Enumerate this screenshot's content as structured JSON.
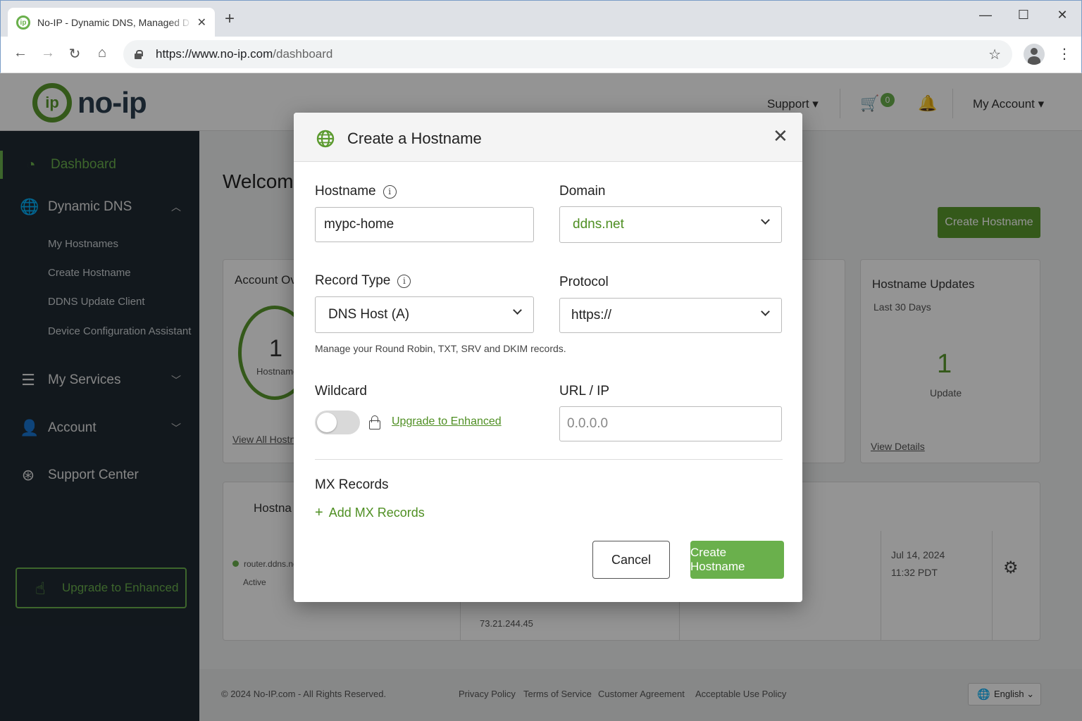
{
  "browser": {
    "tab_title": "No-IP - Dynamic DNS, Managed D",
    "url_host": "https://www.no-ip.com",
    "url_path": "/dashboard",
    "new_tab": "+",
    "close_tab": "✕",
    "minimize": "—",
    "maximize": "☐",
    "close_window": "✕"
  },
  "header": {
    "logo_mark": "ip",
    "logo_text": "no-ip",
    "support": "Support ▾",
    "cart_count": "0",
    "my_account": "My Account ▾"
  },
  "sidebar": {
    "dashboard": "Dashboard",
    "dynamic_dns": "Dynamic DNS",
    "sub": [
      "My Hostnames",
      "Create Hostname",
      "DDNS Update Client",
      "Device Configuration Assistant"
    ],
    "my_services": "My Services",
    "account": "Account",
    "support_center": "Support Center",
    "upgrade": "Upgrade to Enhanced"
  },
  "background": {
    "welcome": "Welcome",
    "create_hostname": "Create Hostname",
    "account_overview": "Account Ove",
    "ring_number": "1",
    "ring_label": "Hostname",
    "view_all": "View All Hostna",
    "updates_title": "Hostname Updates",
    "updates_period": "Last 30 Days",
    "updates_count": "1",
    "updates_label": "Update",
    "view_details": "View Details",
    "hostnames_heading": "Hostna",
    "row_host": "router.ddns.net",
    "row_status": "Active",
    "row_ip": "73.21.244.45",
    "row_date": "Jul 14, 2024",
    "row_time": "11:32 PDT"
  },
  "footer": {
    "copyright": "© 2024 No-IP.com   -   All Rights Reserved.",
    "privacy": "Privacy Policy",
    "terms": "Terms of Service",
    "customer": "Customer Agreement",
    "acceptable": "Acceptable Use Policy",
    "language": "English ⌄"
  },
  "modal": {
    "title": "Create a Hostname",
    "close": "✕",
    "hostname_label": "Hostname",
    "hostname_value": "mypc-home",
    "domain_label": "Domain",
    "domain_value": "ddns.net",
    "record_type_label": "Record Type",
    "record_type_value": "DNS Host (A)",
    "protocol_label": "Protocol",
    "protocol_value": "https://",
    "helper_text": "Manage your Round Robin, TXT, SRV and DKIM records.",
    "wildcard_label": "Wildcard",
    "wildcard_enabled": false,
    "upgrade_link": "Upgrade to Enhanced",
    "url_ip_label": "URL / IP",
    "url_ip_placeholder": "0.0.0.0",
    "mx_title": "MX Records",
    "add_mx": "Add MX Records",
    "cancel": "Cancel",
    "create": "Create Hostname"
  },
  "colors": {
    "accent": "#6ab04c",
    "sidebar": "#1f2a33",
    "link": "#2a6db5"
  }
}
